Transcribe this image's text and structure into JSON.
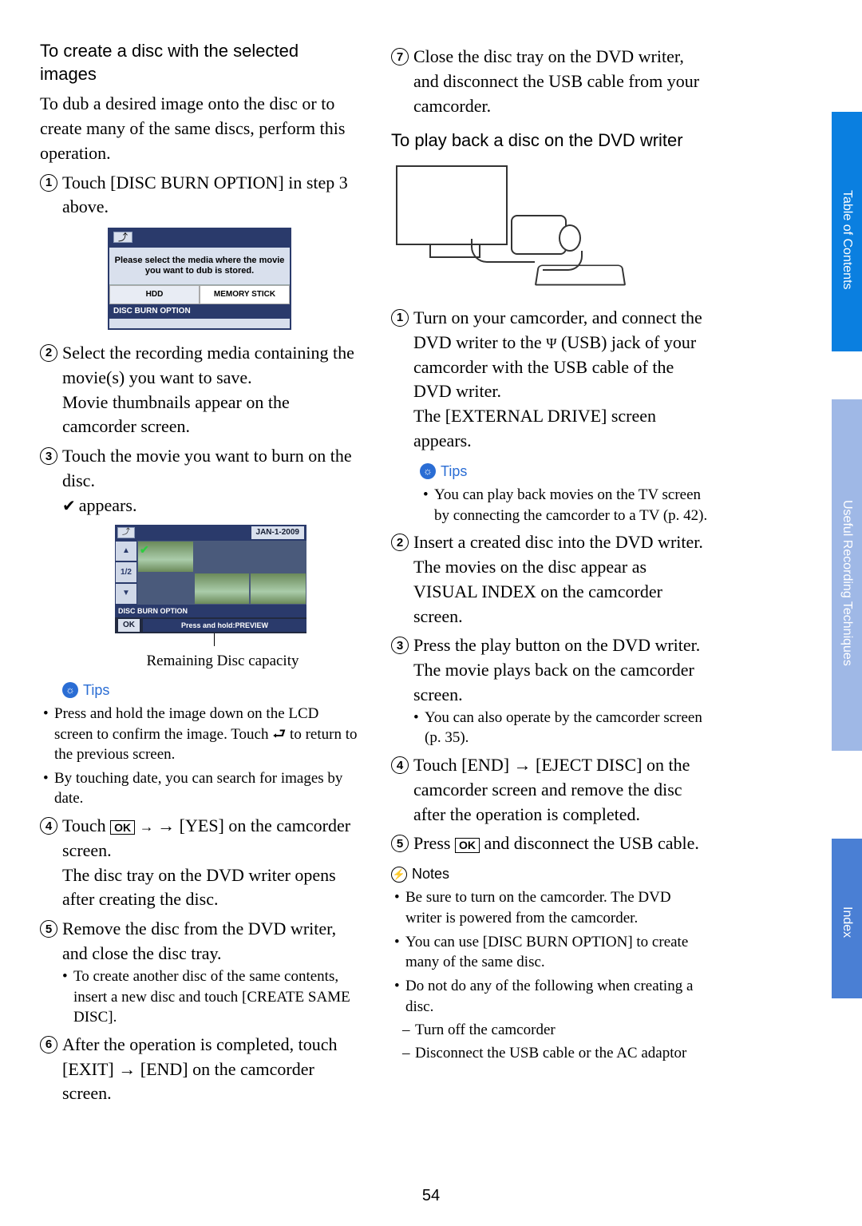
{
  "page_number": "54",
  "sidetabs": {
    "toc": "Table of Contents",
    "urt": "Useful Recording Techniques",
    "index": "Index"
  },
  "left": {
    "h1": "To create a disc with the selected images",
    "intro": "To dub a desired image onto the disc or to create many of the same discs, perform this operation.",
    "s1": "Touch [DISC BURN OPTION] in step 3 above.",
    "ui1": {
      "msg": "Please select the media where the movie you want to dub is stored.",
      "hdd": "HDD",
      "ms": "MEMORY STICK",
      "dbo": "DISC BURN OPTION"
    },
    "s2": "Select the recording media containing the movie(s) you want to save.",
    "s2b": "Movie thumbnails appear on the camcorder screen.",
    "s3": "Touch the movie you want to burn on the disc.",
    "s3b": "appears.",
    "ui2": {
      "date": "JAN-1-2009",
      "page": "1/2",
      "dbo": "DISC BURN OPTION",
      "ok": "OK",
      "preview": "Press and hold:PREVIEW"
    },
    "caption": "Remaining Disc capacity",
    "tips_label": "Tips",
    "tips": [
      "Press and hold the image down on the LCD screen to confirm the image. Touch ⮐ to return to the previous screen.",
      "By touching date, you can search for images by date."
    ],
    "s4a": "Touch ",
    "s4b": " → [YES] on the camcorder screen.",
    "s4c": "The disc tray on the DVD writer opens after creating the disc.",
    "ok_label": "OK",
    "s5": "Remove the disc from the DVD writer, and close the disc tray.",
    "s5tip": "To create another disc of the same contents, insert a new disc and touch [CREATE SAME DISC].",
    "s6": "After the operation is completed, touch [EXIT] → [END] on the camcorder screen."
  },
  "right": {
    "s7": "Close the disc tray on the DVD writer, and disconnect the USB cable from your camcorder.",
    "h2": "To play back a disc on the DVD writer",
    "p1a": "Turn on your camcorder, and connect the DVD writer to the ",
    "p1b": " (USB) jack of your camcorder with the USB cable of the DVD writer.",
    "p1c": "The [EXTERNAL DRIVE] screen appears.",
    "tips_label": "Tips",
    "tips": [
      "You can play back movies on the TV screen by connecting the camcorder to a TV (p. 42)."
    ],
    "p2a": "Insert a created disc into the DVD writer.",
    "p2b": "The movies on the disc appear as VISUAL INDEX on the camcorder screen.",
    "p3a": "Press the play button on the DVD writer. The movie plays back on the camcorder screen.",
    "p3tip": "You can also operate by the camcorder screen (p. 35).",
    "p4": "Touch [END] → [EJECT DISC] on the camcorder screen and remove the disc after the operation is completed.",
    "p5a": "Press ",
    "p5b": " and disconnect the USB cable.",
    "ok_label": "OK",
    "notes_label": "Notes",
    "notes": [
      "Be sure to turn on the camcorder. The DVD writer is powered from the camcorder.",
      "You can use [DISC BURN OPTION] to create many of the same disc.",
      "Do not do any of the following when creating a disc."
    ],
    "notes_sub": [
      "Turn off the camcorder",
      "Disconnect the USB cable or the AC adaptor"
    ]
  }
}
